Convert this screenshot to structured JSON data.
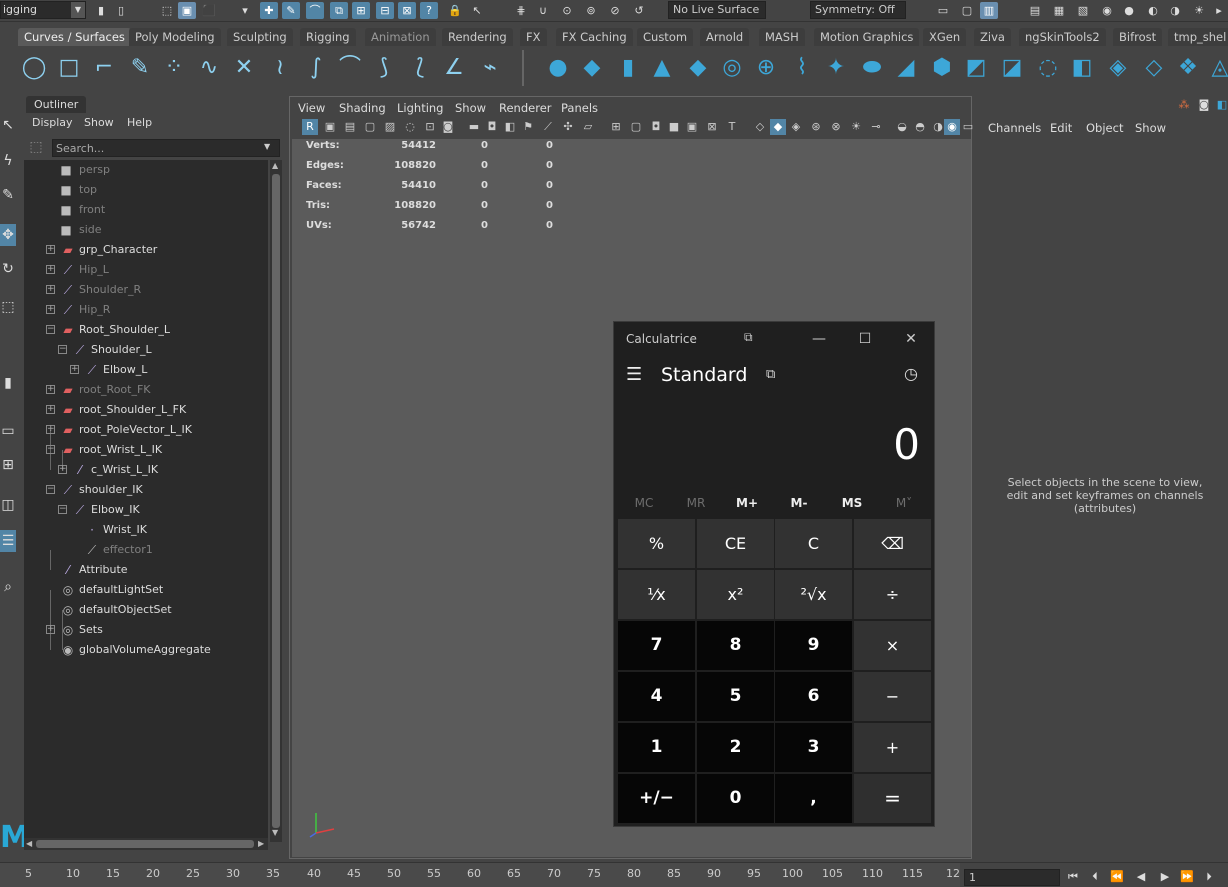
{
  "statusline": {
    "mode": "igging",
    "live_surface": "No Live Surface",
    "symmetry": "Symmetry: Off"
  },
  "shelf": {
    "tabs": [
      {
        "label": "Curves / Surfaces",
        "active": true
      },
      {
        "label": "Poly Modeling"
      },
      {
        "label": "Sculpting"
      },
      {
        "label": "Rigging"
      },
      {
        "label": "Animation"
      },
      {
        "label": "Rendering"
      },
      {
        "label": "FX"
      },
      {
        "label": "FX Caching"
      },
      {
        "label": "Custom"
      },
      {
        "label": "Arnold"
      },
      {
        "label": "MASH"
      },
      {
        "label": "Motion Graphics"
      },
      {
        "label": "XGen"
      },
      {
        "label": "Ziva"
      },
      {
        "label": "ngSkinTools2"
      },
      {
        "label": "Bifrost"
      },
      {
        "label": "tmp_shel"
      }
    ]
  },
  "outliner": {
    "title": "Outliner",
    "menu": [
      "Display",
      "Show",
      "Help"
    ],
    "search_placeholder": "Search...",
    "rows": [
      {
        "label": "persp",
        "dim": true
      },
      {
        "label": "top",
        "dim": true
      },
      {
        "label": "front",
        "dim": true
      },
      {
        "label": "side",
        "dim": true
      },
      {
        "label": "grp_Character"
      },
      {
        "label": "Hip_L",
        "dim": true
      },
      {
        "label": "Shoulder_R",
        "dim": true
      },
      {
        "label": "Hip_R",
        "dim": true
      },
      {
        "label": "Root_Shoulder_L"
      },
      {
        "label": "Shoulder_L"
      },
      {
        "label": "Elbow_L"
      },
      {
        "label": "root_Root_FK",
        "dim": true
      },
      {
        "label": "root_Shoulder_L_FK"
      },
      {
        "label": "root_PoleVector_L_IK"
      },
      {
        "label": "root_Wrist_L_IK"
      },
      {
        "label": "c_Wrist_L_IK"
      },
      {
        "label": "shoulder_IK"
      },
      {
        "label": "Elbow_IK"
      },
      {
        "label": "Wrist_IK"
      },
      {
        "label": "effector1",
        "dim": true
      },
      {
        "label": "Attribute"
      },
      {
        "label": "defaultLightSet"
      },
      {
        "label": "defaultObjectSet"
      },
      {
        "label": "Sets"
      },
      {
        "label": "globalVolumeAggregate"
      }
    ]
  },
  "viewport": {
    "menu": [
      "View",
      "Shading",
      "Lighting",
      "Show",
      "Renderer",
      "Panels"
    ],
    "hud": [
      {
        "label": "Verts:",
        "value": "54412",
        "sel": "0",
        "uv": "0"
      },
      {
        "label": "Edges:",
        "value": "108820",
        "sel": "0",
        "uv": "0"
      },
      {
        "label": "Faces:",
        "value": "54410",
        "sel": "0",
        "uv": "0"
      },
      {
        "label": "Tris:",
        "value": "108820",
        "sel": "0",
        "uv": "0"
      },
      {
        "label": "UVs:",
        "value": "56742",
        "sel": "0",
        "uv": "0"
      }
    ]
  },
  "calculator": {
    "title": "Calculatrice",
    "mode": "Standard",
    "display": "0",
    "memory": [
      {
        "label": "MC",
        "enabled": false
      },
      {
        "label": "MR",
        "enabled": false
      },
      {
        "label": "M+",
        "enabled": true
      },
      {
        "label": "M-",
        "enabled": true
      },
      {
        "label": "MS",
        "enabled": true
      },
      {
        "label": "M˅",
        "enabled": false
      }
    ],
    "keys": [
      {
        "label": "%",
        "type": "op"
      },
      {
        "label": "CE",
        "type": "op"
      },
      {
        "label": "C",
        "type": "op"
      },
      {
        "label": "⌫",
        "type": "op"
      },
      {
        "label": "¹⁄x",
        "type": "op"
      },
      {
        "label": "x²",
        "type": "op"
      },
      {
        "label": "²√x",
        "type": "op"
      },
      {
        "label": "÷",
        "type": "op"
      },
      {
        "label": "7",
        "type": "num"
      },
      {
        "label": "8",
        "type": "num"
      },
      {
        "label": "9",
        "type": "num"
      },
      {
        "label": "×",
        "type": "op"
      },
      {
        "label": "4",
        "type": "num"
      },
      {
        "label": "5",
        "type": "num"
      },
      {
        "label": "6",
        "type": "num"
      },
      {
        "label": "−",
        "type": "op"
      },
      {
        "label": "1",
        "type": "num"
      },
      {
        "label": "2",
        "type": "num"
      },
      {
        "label": "3",
        "type": "num"
      },
      {
        "label": "+",
        "type": "op"
      },
      {
        "label": "+/−",
        "type": "num"
      },
      {
        "label": "0",
        "type": "num"
      },
      {
        "label": ",",
        "type": "num"
      },
      {
        "label": "=",
        "type": "eq"
      }
    ]
  },
  "channelbox": {
    "menu": [
      "Channels",
      "Edit",
      "Object",
      "Show"
    ],
    "empty_message": "Select objects in the scene to view, edit and set keyframes on channels (attributes)"
  },
  "timeslider": {
    "ticks": [
      "5",
      "10",
      "15",
      "20",
      "25",
      "30",
      "35",
      "40",
      "45",
      "50",
      "55",
      "60",
      "65",
      "70",
      "75",
      "80",
      "85",
      "90",
      "95",
      "100",
      "105",
      "110",
      "115",
      "12"
    ],
    "current_frame": "1"
  }
}
